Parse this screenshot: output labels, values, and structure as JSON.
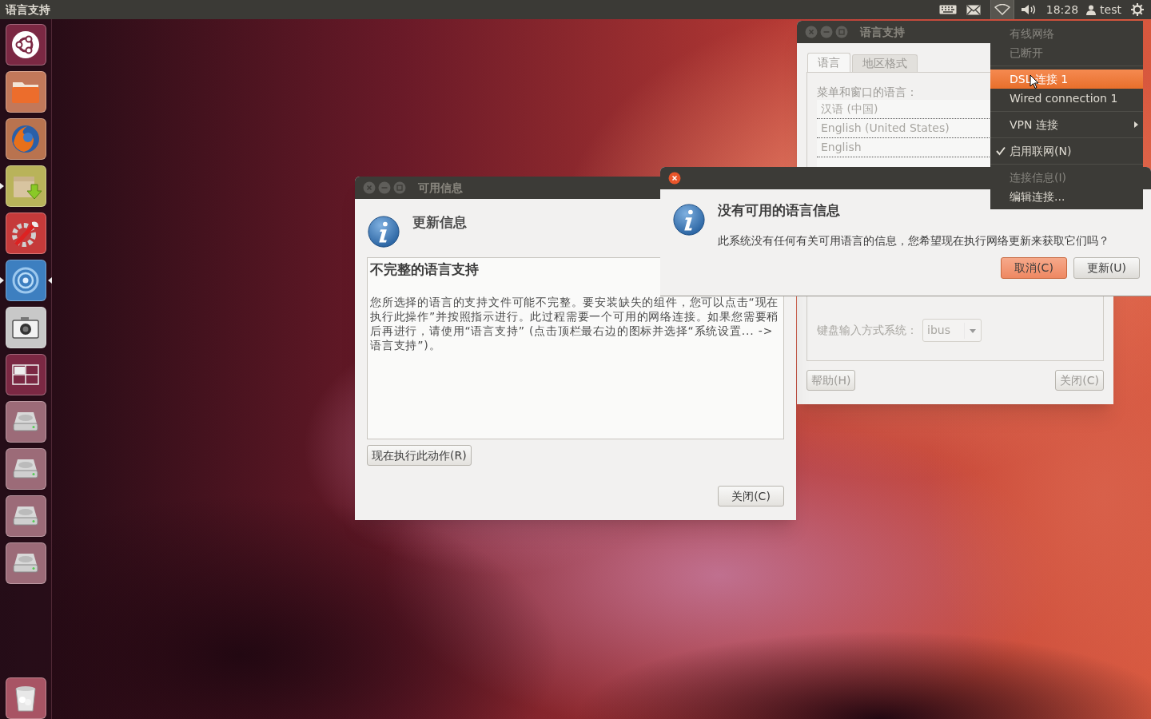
{
  "top_panel": {
    "app_title": "语言支持",
    "network_indicator_open": true,
    "clock": "18:28",
    "user": "test"
  },
  "launcher": [
    {
      "kind": "ubuntu",
      "running": false,
      "active": false
    },
    {
      "kind": "folder",
      "running": false,
      "active": false
    },
    {
      "kind": "browser",
      "running": false,
      "active": false
    },
    {
      "kind": "package",
      "running": true,
      "active": false
    },
    {
      "kind": "settings",
      "running": false,
      "active": false
    },
    {
      "kind": "network",
      "running": true,
      "active": true
    },
    {
      "kind": "camera",
      "running": false,
      "active": false
    },
    {
      "kind": "workspaces",
      "running": false,
      "active": false
    },
    {
      "kind": "drive",
      "running": false,
      "active": false
    },
    {
      "kind": "drive",
      "running": false,
      "active": false
    },
    {
      "kind": "drive",
      "running": false,
      "active": false
    },
    {
      "kind": "drive",
      "running": false,
      "active": false
    },
    {
      "kind": "trash",
      "running": false,
      "active": false
    }
  ],
  "language_window": {
    "title": "语言支持",
    "tabs": [
      {
        "label": "语言",
        "selected": true
      },
      {
        "label": "地区格式",
        "selected": false
      }
    ],
    "languages_label": "菜单和窗口的语言：",
    "languages": [
      "汉语 (中国)",
      "English (United States)",
      "English"
    ],
    "keyboard_label": "键盘输入方式系统：",
    "keyboard_value": "ibus",
    "help_button": "帮助(H)",
    "close_button": "关闭(C)"
  },
  "info_window": {
    "title": "可用信息",
    "heading": "更新信息",
    "box_title": "不完整的语言支持",
    "box_text": "您所选择的语言的支持文件可能不完整。要安装缺失的组件，您可以点击“现在执行此操作”并按照指示进行。此过程需要一个可用的网络连接。如果您需要稍后再进行，请使用“语言支持” (点击顶栏最右边的图标并选择“系统设置... -> 语言支持”)。",
    "action_button": "现在执行此动作(R)",
    "close_button": "关闭(C)"
  },
  "dialog": {
    "heading": "没有可用的语言信息",
    "message": "此系统没有任何有关可用语言的信息，您希望现在执行网络更新来获取它们吗？",
    "buttons": [
      {
        "label": "取消(C)",
        "default": true
      },
      {
        "label": "更新(U)",
        "default": false
      }
    ]
  },
  "network_menu": [
    {
      "kind": "item",
      "label": "有线网络",
      "disabled": true,
      "selected": false,
      "checked": false,
      "submenu": false
    },
    {
      "kind": "item",
      "label": "已断开",
      "disabled": true,
      "selected": false,
      "checked": false,
      "submenu": false
    },
    {
      "kind": "separator"
    },
    {
      "kind": "item",
      "label": "DSL 连接 1",
      "disabled": false,
      "selected": true,
      "checked": false,
      "submenu": false
    },
    {
      "kind": "item",
      "label": "Wired connection 1",
      "disabled": false,
      "selected": false,
      "checked": false,
      "submenu": false
    },
    {
      "kind": "separator"
    },
    {
      "kind": "item",
      "label": "VPN 连接",
      "disabled": false,
      "selected": false,
      "checked": false,
      "submenu": true
    },
    {
      "kind": "separator"
    },
    {
      "kind": "item",
      "label": "启用联网(N)",
      "disabled": false,
      "selected": false,
      "checked": true,
      "submenu": false
    },
    {
      "kind": "separator"
    },
    {
      "kind": "item",
      "label": "连接信息(I)",
      "disabled": true,
      "selected": false,
      "checked": false,
      "submenu": false
    },
    {
      "kind": "item",
      "label": "编辑连接...",
      "disabled": false,
      "selected": false,
      "checked": false,
      "submenu": false
    }
  ]
}
